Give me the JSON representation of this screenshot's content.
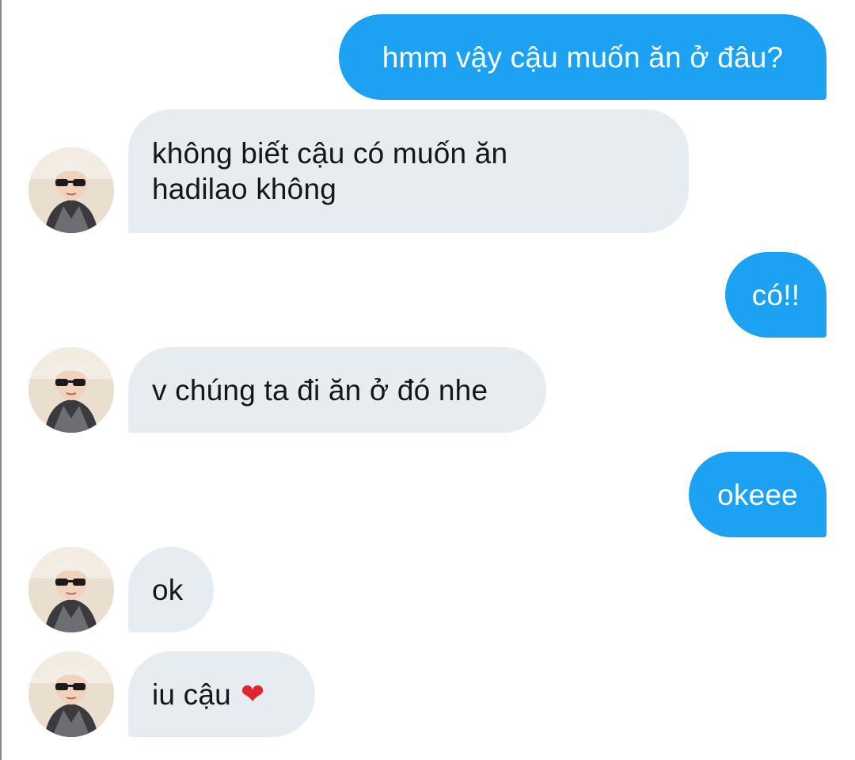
{
  "messages": [
    {
      "side": "out",
      "text": "hmm vậy cậu muốn ăn ở đâu?"
    },
    {
      "side": "in",
      "lines": [
        "không biết cậu có muốn ăn",
        "hadilao không"
      ]
    },
    {
      "side": "out",
      "text": "có!!"
    },
    {
      "side": "in",
      "text": "v chúng ta đi ăn ở đó nhe"
    },
    {
      "side": "out",
      "text": "okeee"
    },
    {
      "side": "in",
      "text": "ok"
    },
    {
      "side": "in",
      "text": "iu cậu",
      "emoji": "❤"
    }
  ],
  "colors": {
    "outgoing_bubble": "#1da1f2",
    "incoming_bubble": "#e6ecf0",
    "outgoing_text": "#ffffff",
    "incoming_text": "#14171a",
    "heart": "#e0262d"
  },
  "icons": {
    "avatar": "profile-photo-person-sunglasses"
  }
}
